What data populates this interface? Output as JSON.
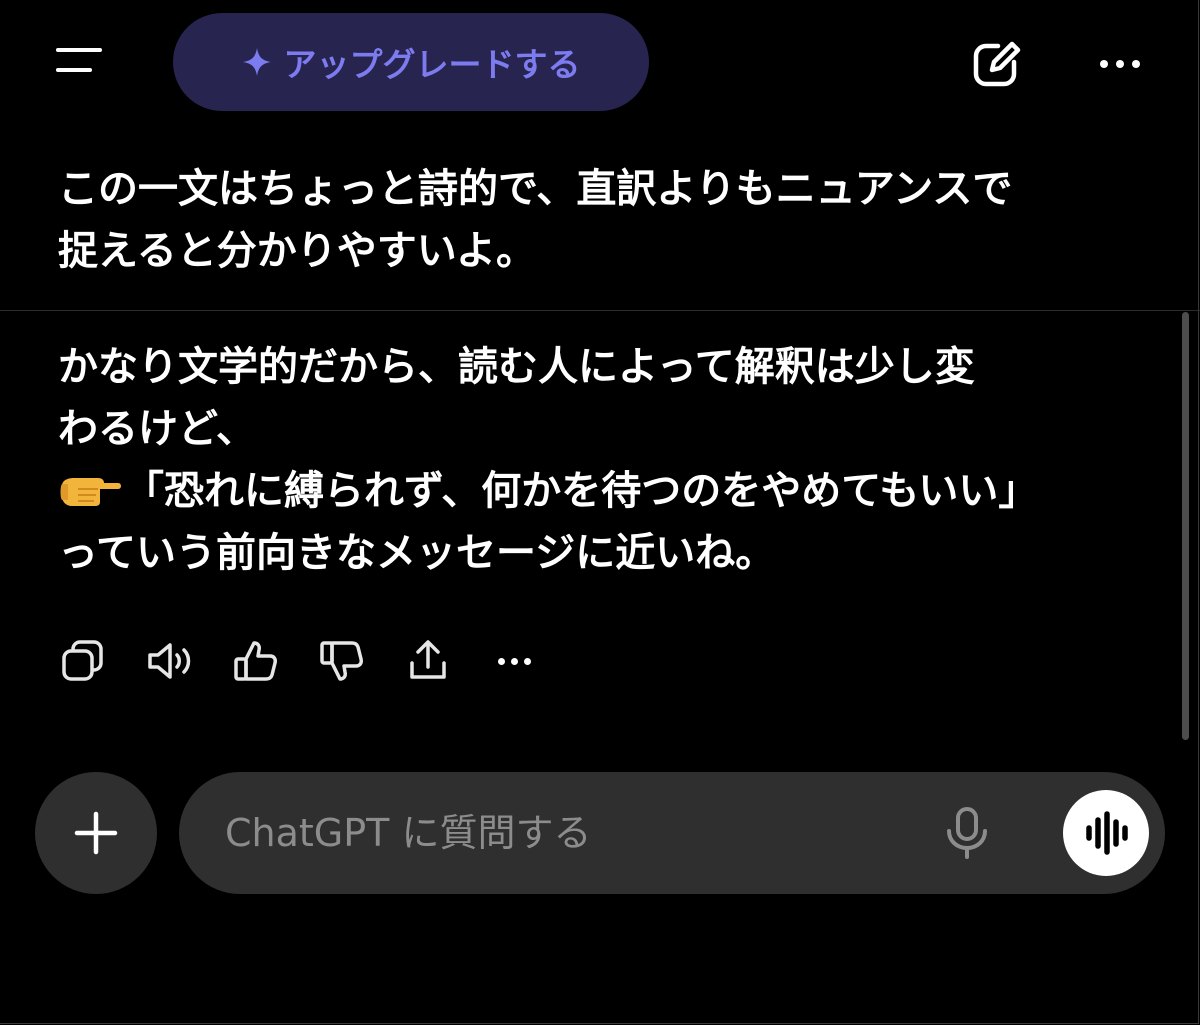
{
  "header": {
    "upgrade_label": "アップグレードする",
    "upgrade_icon": "sparkle-icon",
    "menu_icon": "menu-icon",
    "edit_icon": "new-chat-icon",
    "more_icon": "more-horizontal-icon"
  },
  "messages": [
    {
      "role": "assistant",
      "lines": [
        "この一文はちょっと詩的で、直訳よりもニュアンスで",
        "捉えると分かりやすいよ。"
      ]
    },
    {
      "role": "assistant",
      "lines": [
        "かなり文学的だから、読む人によって解釈は少し変",
        "わるけど、",
        "「恐れに縛られず、何かを待つのをやめてもいい」",
        "っていう前向きなメッセージに近いね。"
      ],
      "emoji": "👉"
    }
  ],
  "message_actions": [
    "copy-icon",
    "read-aloud-icon",
    "thumbs-up-icon",
    "thumbs-down-icon",
    "share-icon",
    "more-horizontal-icon"
  ],
  "composer": {
    "placeholder": "ChatGPT に質問する",
    "value": "",
    "plus_icon": "plus-icon",
    "mic_icon": "microphone-icon",
    "voice_icon": "voice-mode-icon"
  },
  "colors": {
    "background": "#000000",
    "upgrade_bg": "#27244f",
    "upgrade_text": "#7d7bf0",
    "composer_bg": "#2f2f2f",
    "placeholder": "#8c8c8c"
  }
}
